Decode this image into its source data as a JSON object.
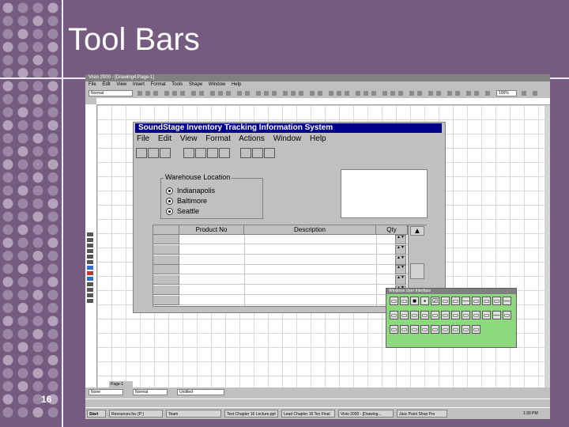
{
  "slide": {
    "title": "Tool Bars",
    "page_number": "16"
  },
  "app": {
    "title": "Visio 2000 - [Drawing4:Page-1]",
    "menus": [
      "File",
      "Edit",
      "View",
      "Insert",
      "Format",
      "Tools",
      "Shape",
      "Window",
      "Help"
    ],
    "style_combo": "Normal",
    "zoom": "100%"
  },
  "form": {
    "title": "SoundStage Inventory Tracking Information System",
    "menus": [
      "File",
      "Edit",
      "View",
      "Format",
      "Actions",
      "Window",
      "Help"
    ],
    "frame_label": "Warehouse Location",
    "locations": [
      "Indianapolis",
      "Baltimore",
      "Seattle"
    ],
    "columns": [
      "Product No",
      "Description",
      "Qty"
    ]
  },
  "toolbox": {
    "title": "Windows User Interface"
  },
  "bottom": {
    "page_tab": "Page-1",
    "combo1": "None",
    "combo2": "Normal",
    "combo3": "Untitled"
  },
  "taskbar": {
    "start": "Start",
    "items": [
      "Resources.fsv (P:)",
      "Team",
      "Text Chapter 16 Lecture.ppt",
      "Lead Chapter 16 Tex Final",
      "Visio 2000 - [Drawing...",
      "Jasc Paint Shop Pro"
    ],
    "clock": "1:30 PM"
  }
}
